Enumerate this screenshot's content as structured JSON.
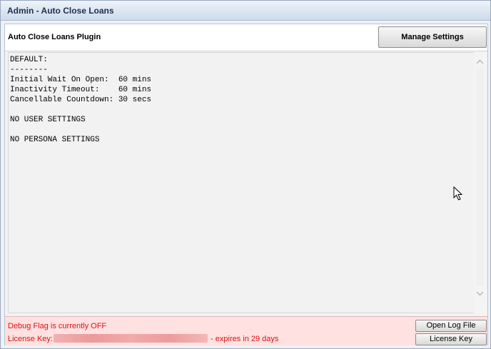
{
  "window": {
    "title": "Admin - Auto Close Loans"
  },
  "header": {
    "plugin_title": "Auto Close Loans Plugin",
    "manage_settings_label": "Manage Settings"
  },
  "content": {
    "lines": [
      "DEFAULT:",
      "--------",
      "Initial Wait On Open:  60 mins",
      "Inactivity Timeout:    60 mins",
      "Cancellable Countdown: 30 secs",
      "",
      "NO USER SETTINGS",
      "",
      "NO PERSONA SETTINGS"
    ]
  },
  "scrollbar": {
    "up_icon": "chevron-up-icon",
    "down_icon": "chevron-down-icon"
  },
  "footer": {
    "debug_text": "Debug Flag is currently OFF",
    "license_label": "License Key:",
    "license_expiry": " - expires in 29 days",
    "open_log_label": "Open Log File",
    "license_key_label": "License Key"
  },
  "colors": {
    "footer_background": "#ffe1e1",
    "footer_text": "#e01010",
    "title_text": "#1b2f4f"
  }
}
